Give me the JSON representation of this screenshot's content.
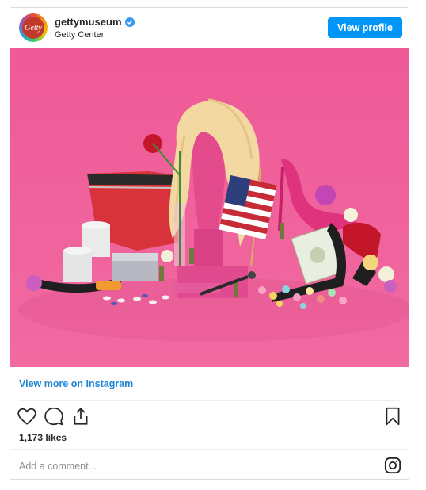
{
  "header": {
    "username": "gettymuseum",
    "location": "Getty Center",
    "avatar_text": "Getty",
    "view_profile_label": "View profile"
  },
  "post": {
    "image_alt": "Still life of wig, flag, shoe, candles, flowers on pink background",
    "view_more_label": "View more on Instagram",
    "likes": "1,173 likes",
    "comment_placeholder": "Add a comment..."
  },
  "colors": {
    "accent": "#0095f6",
    "link": "#1e86d6",
    "photo_background": "#ee5f99"
  },
  "icons": [
    "verified-badge-icon",
    "heart-icon",
    "comment-icon",
    "share-icon",
    "bookmark-icon",
    "instagram-icon"
  ]
}
